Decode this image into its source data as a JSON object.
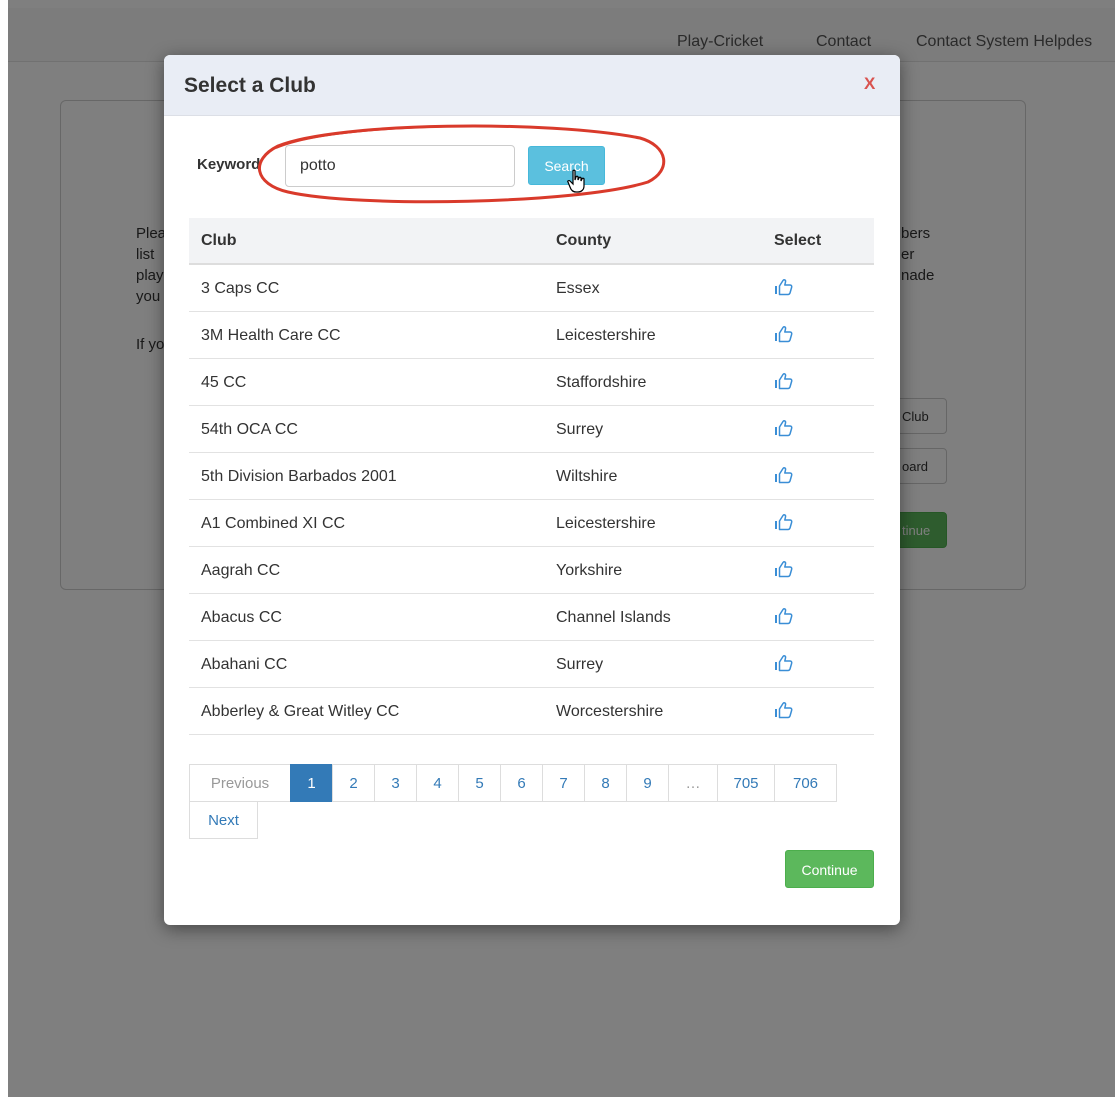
{
  "nav": {
    "items": [
      "Play-Cricket",
      "Contact",
      "Contact System Helpdes"
    ]
  },
  "background": {
    "left_fragments": [
      "Plea",
      "list",
      "play",
      "you",
      "If yo"
    ],
    "right_fragments": [
      "bers",
      "er",
      "nade"
    ],
    "button_fragments": [
      "Club",
      "oard",
      "tinue"
    ]
  },
  "modal": {
    "title": "Select a Club",
    "close_label": "X",
    "keyword_label": "Keyword",
    "keyword_value": "potto",
    "search_label": "Search",
    "columns": [
      "Club",
      "County",
      "Select"
    ],
    "rows": [
      {
        "club": "3 Caps CC",
        "county": "Essex"
      },
      {
        "club": "3M Health Care CC",
        "county": "Leicestershire"
      },
      {
        "club": "45 CC",
        "county": "Staffordshire"
      },
      {
        "club": "54th OCA CC",
        "county": "Surrey"
      },
      {
        "club": "5th Division Barbados 2001",
        "county": "Wiltshire"
      },
      {
        "club": "A1 Combined XI CC",
        "county": "Leicestershire"
      },
      {
        "club": "Aagrah CC",
        "county": "Yorkshire"
      },
      {
        "club": "Abacus CC",
        "county": "Channel Islands"
      },
      {
        "club": "Abahani CC",
        "county": "Surrey"
      },
      {
        "club": "Abberley & Great Witley CC",
        "county": "Worcestershire"
      }
    ],
    "select_icon": "thumbs-up-icon",
    "pagination": {
      "previous": "Previous",
      "pages": [
        "1",
        "2",
        "3",
        "4",
        "5",
        "6",
        "7",
        "8",
        "9",
        "…",
        "705",
        "706"
      ],
      "current": "1",
      "next": "Next"
    },
    "continue_label": "Continue"
  },
  "colors": {
    "accent_blue": "#337ab7",
    "search_blue": "#5bc0de",
    "continue_green": "#5cb85c",
    "close_red": "#d9534f",
    "annotation_red": "#d93a2b"
  }
}
